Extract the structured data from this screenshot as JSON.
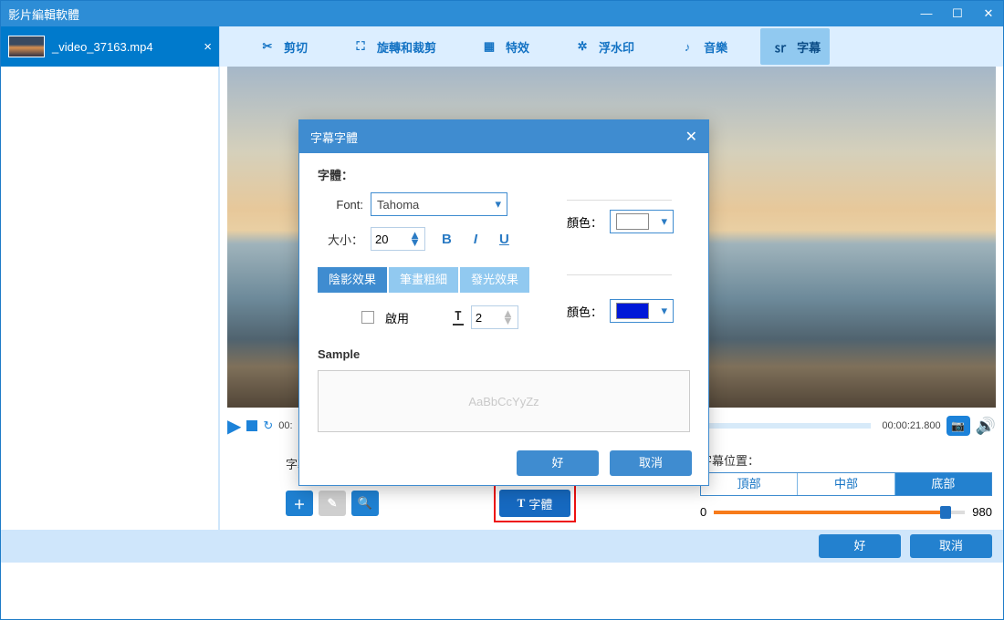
{
  "app_title": "影片編輯軟體",
  "file_tab": {
    "name": "_video_37163.mp4"
  },
  "toolbar": {
    "cut": "剪切",
    "rotate": "旋轉和裁剪",
    "effects": "特效",
    "watermark": "浮水印",
    "music": "音樂",
    "subtitle": "字幕"
  },
  "playback": {
    "start_time": "00:",
    "end_time": "00:00:21.800"
  },
  "subtitle": {
    "label": "字幕：",
    "input_value": "",
    "font_button": "字體",
    "position_label": "字幕位置：",
    "pos_top": "頂部",
    "pos_mid": "中部",
    "pos_bottom": "底部",
    "slider_min": "0",
    "slider_max": "980"
  },
  "footer": {
    "ok": "好",
    "cancel": "取消"
  },
  "dialog": {
    "title": "字幕字體",
    "font_section": "字體：",
    "font_label": "Font:",
    "font_value": "Tahoma",
    "size_label": "大小：",
    "size_value": "20",
    "color_label": "顏色：",
    "effect_tabs": {
      "shadow": "陰影效果",
      "stroke": "筆畫粗細",
      "glow": "發光效果"
    },
    "enable_label": "啟用",
    "outline_value": "2",
    "color2_label": "顏色：",
    "sample_label": "Sample",
    "sample_text": "AaBbCcYyZz",
    "ok": "好",
    "cancel": "取消"
  }
}
